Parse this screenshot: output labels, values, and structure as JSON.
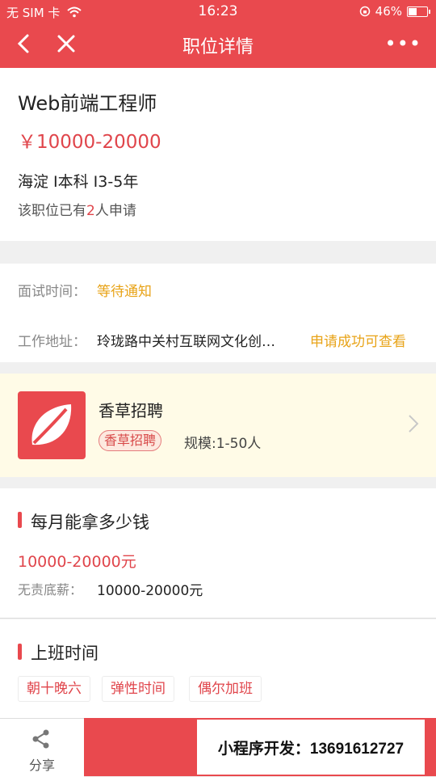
{
  "status_bar": {
    "carrier": "无 SIM 卡",
    "time": "16:23",
    "battery": "46%"
  },
  "nav": {
    "title": "职位详情",
    "more": "•••"
  },
  "job": {
    "title": "Web前端工程师",
    "salary": "￥10000-20000",
    "meta": "海淀 I本科 I3-5年",
    "applied_prefix": "该职位已有",
    "applied_count": "2",
    "applied_suffix": "人申请"
  },
  "details": {
    "interview_label": "面试时间：",
    "interview_value": "等待通知",
    "address_label": "工作地址：",
    "address_value": "玲珑路中关村互联网文化创…",
    "address_hint": "申请成功可查看"
  },
  "company": {
    "name": "香草招聘",
    "tag": "香草招聘",
    "scale": "规模:1-50人"
  },
  "pay_section": {
    "title": "每月能拿多少钱",
    "range": "10000-20000元",
    "base_label": "无责底薪：",
    "base_value": "10000-20000元"
  },
  "hours_section": {
    "title": "上班时间",
    "tags": [
      "朝十晚六",
      "弹性时间",
      "偶尔加班"
    ]
  },
  "bottom": {
    "share_label": "分享",
    "dev_text": "小程序开发：13691612727"
  },
  "colors": {
    "brand": "#e9494e",
    "accent_yellow": "#e8a317",
    "company_bg": "#fffbe7"
  },
  "icons": {
    "share": "share-icon",
    "back": "back-icon",
    "close": "close-icon",
    "wifi": "wifi-icon",
    "chevron": "chevron-right-icon"
  }
}
